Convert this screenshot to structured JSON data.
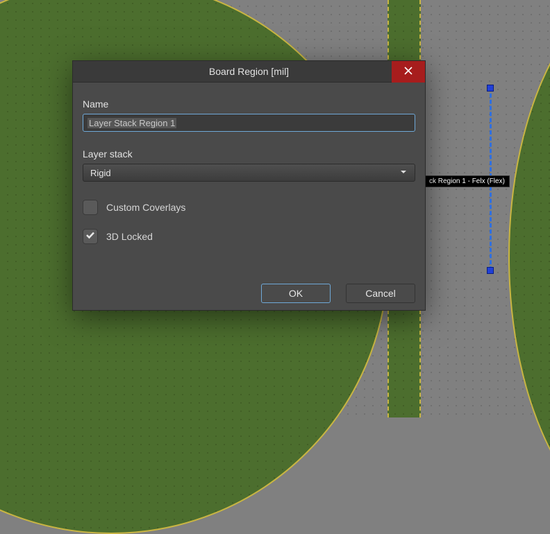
{
  "tooltip": {
    "text": "ck Region 1 - Felx (Flex)"
  },
  "dialog": {
    "title": "Board Region [mil]",
    "name_label": "Name",
    "name_value": "Layer Stack Region 1",
    "layerstack_label": "Layer stack",
    "layerstack_value": "Rigid",
    "custom_coverlays_label": "Custom Coverlays",
    "custom_coverlays_checked": false,
    "locked3d_label": "3D Locked",
    "locked3d_checked": true,
    "ok_label": "OK",
    "cancel_label": "Cancel"
  }
}
